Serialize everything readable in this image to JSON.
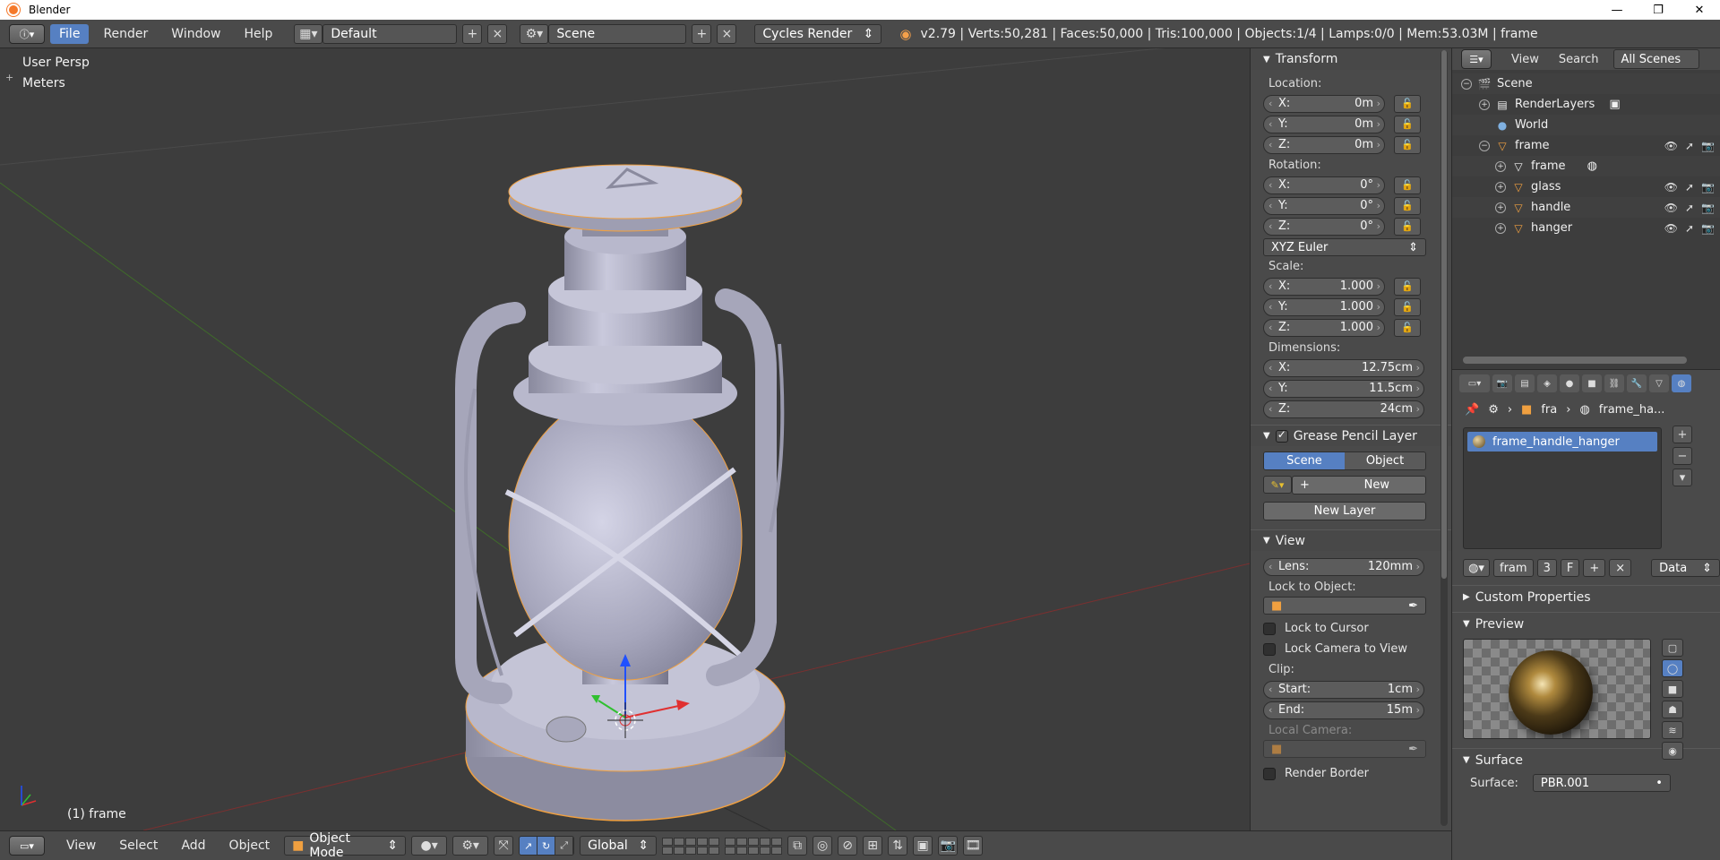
{
  "window": {
    "title": "Blender",
    "controls": [
      "—",
      "❐",
      "✕"
    ]
  },
  "topbar": {
    "menus": [
      "File",
      "Render",
      "Window",
      "Help"
    ],
    "layout": "Default",
    "scene": "Scene",
    "engine": "Cycles Render",
    "stats": "v2.79 | Verts:50,281 | Faces:50,000 | Tris:100,000 | Objects:1/4 | Lamps:0/0 | Mem:53.03M | frame"
  },
  "viewport": {
    "view_name": "User Persp",
    "units": "Meters",
    "active_object": "(1) frame"
  },
  "bottombar": {
    "menus": [
      "View",
      "Select",
      "Add",
      "Object"
    ],
    "mode": "Object Mode",
    "orientation": "Global"
  },
  "npanel": {
    "transform_title": "Transform",
    "location_label": "Location:",
    "location": [
      {
        "axis": "X:",
        "value": "0m"
      },
      {
        "axis": "Y:",
        "value": "0m"
      },
      {
        "axis": "Z:",
        "value": "0m"
      }
    ],
    "rotation_label": "Rotation:",
    "rotation": [
      {
        "axis": "X:",
        "value": "0°"
      },
      {
        "axis": "Y:",
        "value": "0°"
      },
      {
        "axis": "Z:",
        "value": "0°"
      }
    ],
    "rotation_mode": "XYZ Euler",
    "scale_label": "Scale:",
    "scale": [
      {
        "axis": "X:",
        "value": "1.000"
      },
      {
        "axis": "Y:",
        "value": "1.000"
      },
      {
        "axis": "Z:",
        "value": "1.000"
      }
    ],
    "dimensions_label": "Dimensions:",
    "dimensions": [
      {
        "axis": "X:",
        "value": "12.75cm"
      },
      {
        "axis": "Y:",
        "value": "11.5cm"
      },
      {
        "axis": "Z:",
        "value": "24cm"
      }
    ],
    "grease_title": "Grease Pencil Layer",
    "grease_scene": "Scene",
    "grease_object": "Object",
    "grease_new": "New",
    "grease_new_layer": "New Layer",
    "view_title": "View",
    "lens_label": "Lens:",
    "lens_value": "120mm",
    "lock_object_label": "Lock to Object:",
    "lock_cursor": "Lock to Cursor",
    "lock_camera": "Lock Camera to View",
    "clip_label": "Clip:",
    "clip_start_label": "Start:",
    "clip_start": "1cm",
    "clip_end_label": "End:",
    "clip_end": "15m",
    "local_camera": "Local Camera:",
    "render_border": "Render Border"
  },
  "outliner": {
    "view_menu": "View",
    "search_menu": "Search",
    "scenes_dd": "All Scenes",
    "items": [
      {
        "label": "Scene"
      },
      {
        "label": "RenderLayers"
      },
      {
        "label": "World"
      },
      {
        "label": "frame"
      },
      {
        "label": "frame"
      },
      {
        "label": "glass"
      },
      {
        "label": "handle"
      },
      {
        "label": "hanger"
      }
    ]
  },
  "properties": {
    "crumb_object": "fra",
    "crumb_material": "frame_ha...",
    "material_slot": "frame_handle_hanger",
    "slot_name": "fram",
    "slot_users": "3",
    "slot_fake": "F",
    "link_dd": "Data",
    "custom_props": "Custom Properties",
    "preview_title": "Preview",
    "surface_title": "Surface",
    "surface_label": "Surface:",
    "surface_value": "PBR.001"
  },
  "colors": {
    "accent": "#5680c2",
    "selection_outline": "#f0a040",
    "background": "#3d3d3d",
    "panel": "#4a4a4a"
  }
}
